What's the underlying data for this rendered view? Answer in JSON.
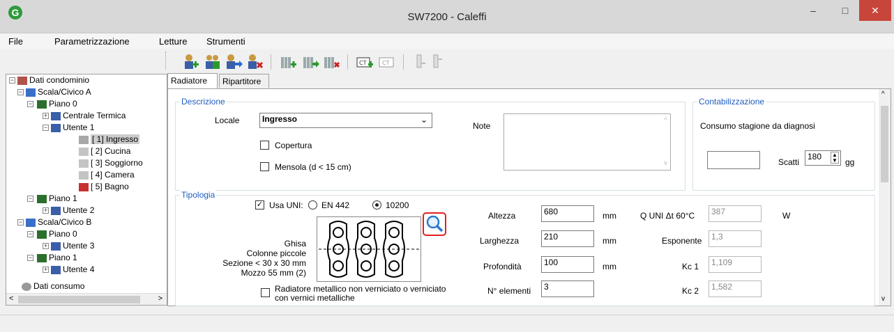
{
  "window": {
    "title": "SW7200 - Caleffi",
    "app_icon": "G",
    "minimize": "–",
    "maximize": "□",
    "close": "✕"
  },
  "menu": [
    "File",
    "Parametrizzazione",
    "Letture",
    "Strumenti"
  ],
  "tree": {
    "root": "Dati condominio",
    "scala_a": "Scala/Civico A",
    "piano_0a": "Piano  0",
    "centrale": "Centrale Termica",
    "utente1": "Utente 1",
    "r1": "[ 1] Ingresso",
    "r2": "[ 2] Cucina",
    "r3": "[ 3] Soggiorno",
    "r4": "[ 4] Camera",
    "r5": "[ 5] Bagno",
    "piano_1a": "Piano  1",
    "utente2": "Utente 2",
    "scala_b": "Scala/Civico B",
    "piano_0b": "Piano  0",
    "utente3": "Utente 3",
    "piano_1b": "Piano  1",
    "utente4": "Utente 4",
    "consumo": "Dati consumo"
  },
  "tabs": [
    "Radiatore",
    "Ripartitore"
  ],
  "descrizione": {
    "title": "Descrizione",
    "locale_label": "Locale",
    "locale_value": "Ingresso",
    "copertura": "Copertura",
    "mensola": "Mensola (d < 15 cm)",
    "note_label": "Note"
  },
  "contabilizzazione": {
    "title": "Contabilizzazione",
    "consumo_label": "Consumo stagione da diagnosi",
    "scatti_label": "Scatti",
    "gg_value": "180",
    "gg_unit": "gg"
  },
  "tipologia": {
    "title": "Tipologia",
    "usa_uni": "Usa UNI:",
    "en442": "EN 442",
    "uni10200": "10200",
    "desc1": "Ghisa",
    "desc2": "Colonne piccole",
    "desc3": "Sezione < 30 x 30 mm",
    "desc4": "Mozzo 55 mm (2)",
    "metallico1": "Radiatore metallico non verniciato o verniciato",
    "metallico2": "con vernici metalliche",
    "altezza_label": "Altezza",
    "altezza": "680",
    "larghezza_label": "Larghezza",
    "larghezza": "210",
    "profondita_label": "Profondità",
    "profondita": "100",
    "elementi_label": "N° elementi",
    "elementi": "3",
    "mm": "mm",
    "quni_label": "Q UNI Δt 60°C",
    "quni": "387",
    "w_unit": "W",
    "esponente_label": "Esponente",
    "esponente": "1,3",
    "kc1_label": "Kc 1",
    "kc1": "1,109",
    "kc2_label": "Kc 2",
    "kc2": "1,582"
  }
}
